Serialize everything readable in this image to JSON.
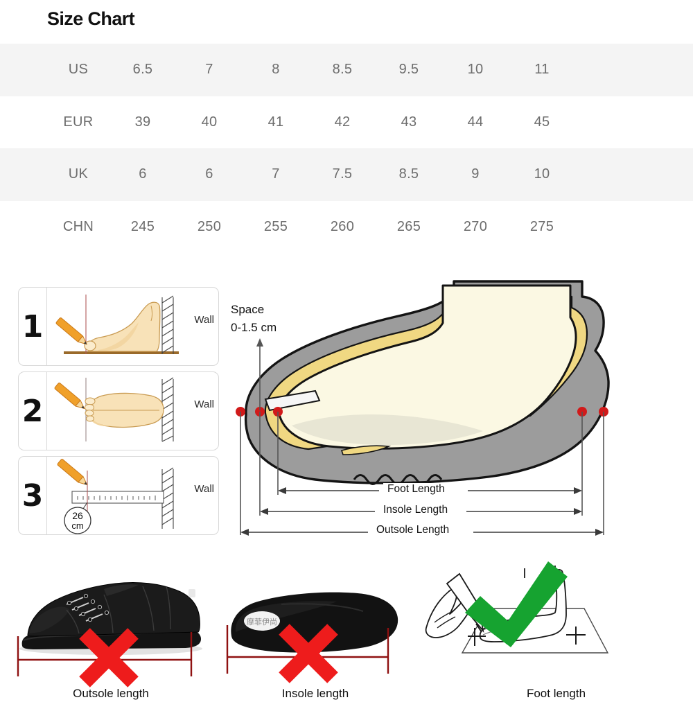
{
  "title": "Size Chart",
  "table": {
    "rows": [
      {
        "label": "US",
        "shaded": true,
        "values": [
          "6.5",
          "7",
          "8",
          "8.5",
          "9.5",
          "10",
          "11"
        ]
      },
      {
        "label": "EUR",
        "shaded": false,
        "values": [
          "39",
          "40",
          "41",
          "42",
          "43",
          "44",
          "45"
        ]
      },
      {
        "label": "UK",
        "shaded": true,
        "values": [
          "6",
          "6",
          "7",
          "7.5",
          "8.5",
          "9",
          "10"
        ]
      },
      {
        "label": "CHN",
        "shaded": false,
        "values": [
          "245",
          "250",
          "255",
          "260",
          "265",
          "270",
          "275"
        ]
      }
    ]
  },
  "steps": [
    {
      "number": "1",
      "wall_label": "Wall"
    },
    {
      "number": "2",
      "wall_label": "Wall"
    },
    {
      "number": "3",
      "wall_label": "Wall",
      "measure_value": "26",
      "measure_unit": "cm"
    }
  ],
  "shoe_diagram": {
    "space_line1": "Space",
    "space_line2": "0-1.5 cm",
    "dim_foot": "Foot Length",
    "dim_insole": "Insole Length",
    "dim_outsole": "Outsole Length"
  },
  "bottom_panels": [
    {
      "caption": "Outsole length",
      "mark": "cross"
    },
    {
      "caption": "Insole length",
      "mark": "cross",
      "logo_text": "摩菲伊尚"
    },
    {
      "caption": "Foot length",
      "mark": "check"
    }
  ],
  "colors": {
    "row_shaded": "#f4f4f4",
    "text_gray": "#6d6d6d",
    "shoe_gray": "#9c9c9c",
    "foot_cream": "#fbf8e3",
    "insole_yellow": "#f0d882",
    "red_dot": "#d11a1a",
    "cross_red": "#ee1c1c",
    "check_green": "#16a330",
    "bracket_red": "#8f1111"
  }
}
